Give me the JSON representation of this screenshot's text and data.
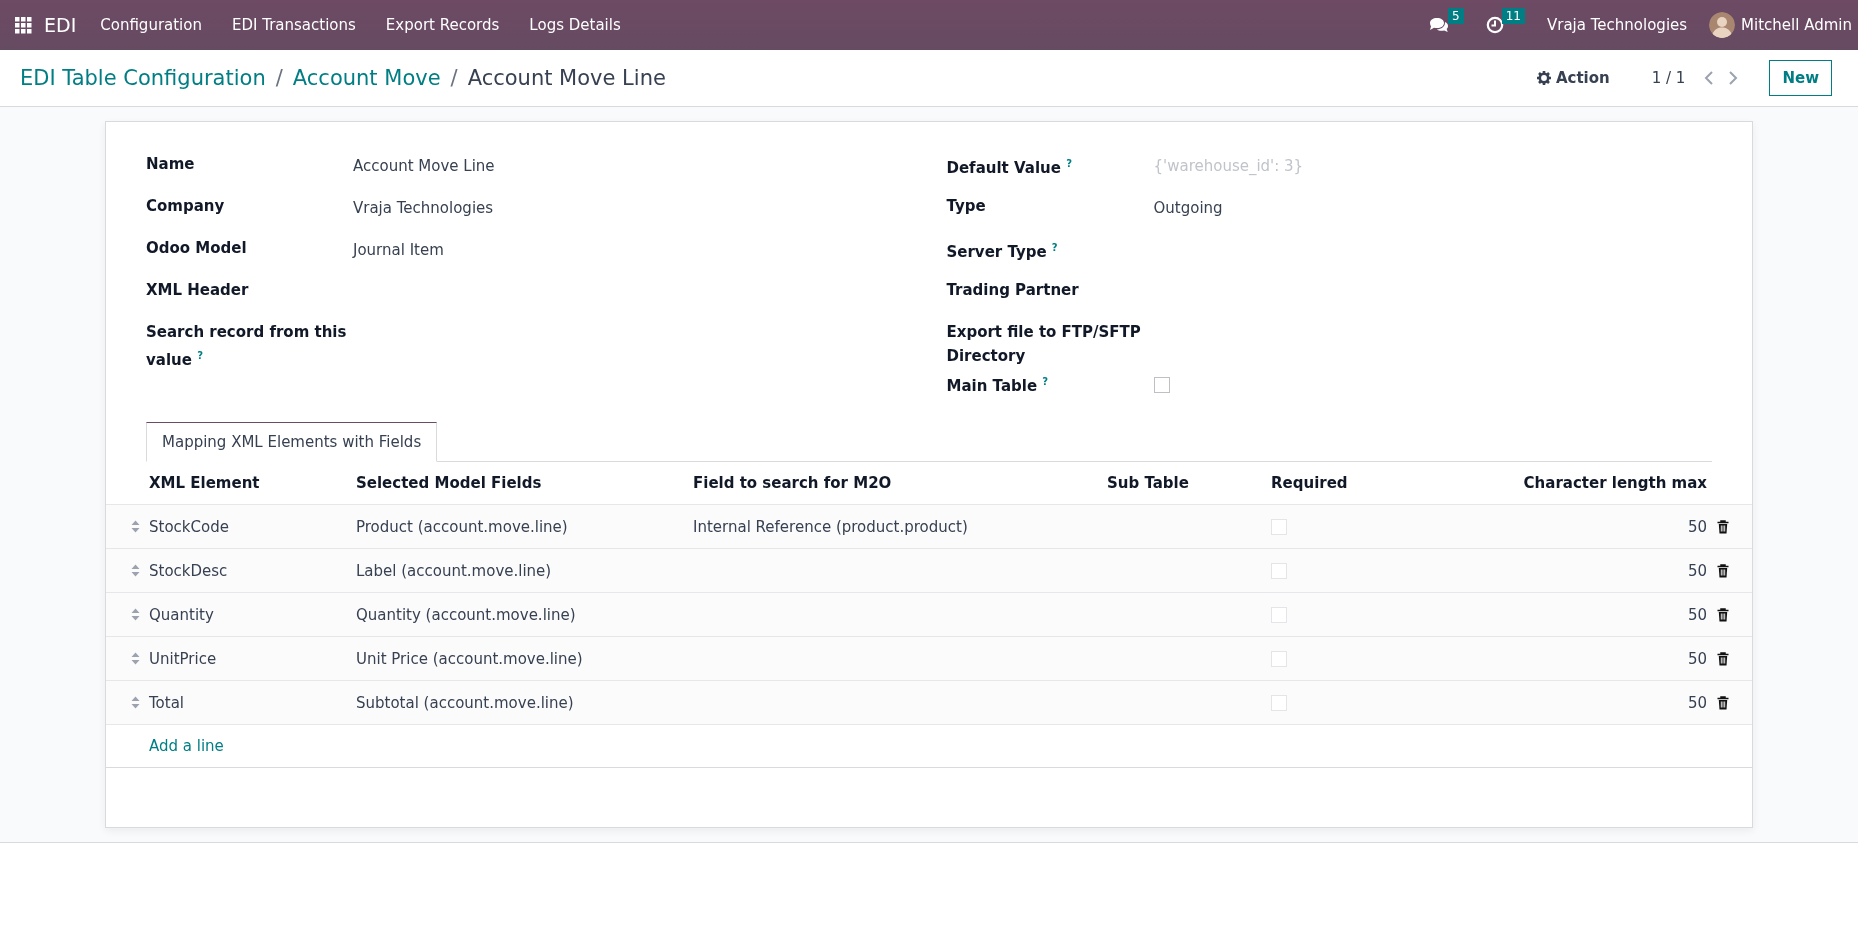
{
  "navbar": {
    "app_name": "EDI",
    "menu": [
      "Configuration",
      "EDI Transactions",
      "Export Records",
      "Logs Details"
    ],
    "messages_count": "5",
    "activities_count": "11",
    "company": "Vraja Technologies",
    "user": "Mitchell Admin"
  },
  "breadcrumbs": [
    {
      "kind": "link",
      "text": "EDI Table Configuration"
    },
    {
      "kind": "separator",
      "text": "/"
    },
    {
      "kind": "link",
      "text": "Account Move"
    },
    {
      "kind": "separator",
      "text": "/"
    },
    {
      "kind": "current",
      "text": "Account Move Line"
    }
  ],
  "control_panel": {
    "action": "Action",
    "pager": "1 / 1",
    "new_button": "New"
  },
  "form": {
    "left_fields": [
      {
        "label": "Name",
        "kind": "text",
        "value": "Account Move Line"
      },
      {
        "label": "Company",
        "kind": "text",
        "value": "Vraja Technologies"
      },
      {
        "label": "Odoo Model",
        "kind": "text",
        "value": "Journal Item"
      },
      {
        "label": "XML Header",
        "kind": "text"
      },
      {
        "label": "Search record from this value",
        "help": "?",
        "kind": "text"
      }
    ],
    "right_fields": [
      {
        "label": "Default Value",
        "help": "?",
        "kind": "placeholder",
        "placeholder": "{'warehouse_id': 3}"
      },
      {
        "label": "Type",
        "kind": "text",
        "value": "Outgoing"
      },
      {
        "label": "Server Type",
        "help": "?",
        "kind": "text"
      },
      {
        "label": "Trading Partner",
        "kind": "text"
      },
      {
        "label": "Export file to FTP/SFTP Directory",
        "kind": "text"
      },
      {
        "label": "Main Table",
        "help": "?",
        "kind": "checkbox",
        "checked": false
      }
    ]
  },
  "tabs": [
    {
      "label": "Mapping XML Elements with Fields",
      "selected": true
    }
  ],
  "table": {
    "columns": [
      "XML Element",
      "Selected Model Fields",
      "Field to search for M2O",
      "Sub Table",
      "Required",
      "Character length max"
    ],
    "rows": [
      {
        "xml_element": "StockCode",
        "model_field": "Product (account.move.line)",
        "m2o_field": "Internal Reference (product.product)",
        "required": false,
        "char_max": "50"
      },
      {
        "xml_element": "StockDesc",
        "model_field": "Label (account.move.line)",
        "required": false,
        "char_max": "50"
      },
      {
        "xml_element": "Quantity",
        "model_field": "Quantity (account.move.line)",
        "required": false,
        "char_max": "50"
      },
      {
        "xml_element": "UnitPrice",
        "model_field": "Unit Price (account.move.line)",
        "required": false,
        "char_max": "50"
      },
      {
        "xml_element": "Total",
        "model_field": "Subtotal (account.move.line)",
        "required": false,
        "char_max": "50"
      }
    ],
    "add_line": "Add a line"
  }
}
